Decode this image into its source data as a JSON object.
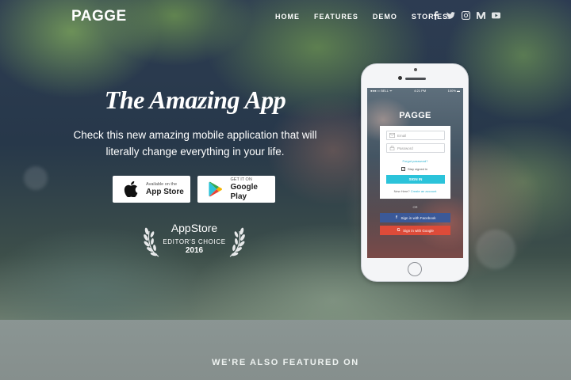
{
  "brand": {
    "logo": "PAGGE"
  },
  "nav": {
    "items": [
      "HOME",
      "FEATURES",
      "DEMO",
      "STORIES"
    ]
  },
  "social_icons": [
    "facebook-icon",
    "twitter-icon",
    "instagram-icon",
    "medium-icon",
    "youtube-icon"
  ],
  "hero": {
    "headline": "The Amazing App",
    "subtext": "Check this new amazing mobile application that will literally change everything in your life."
  },
  "store_buttons": {
    "appstore": {
      "small": "Available on the",
      "big": "App Store"
    },
    "googleplay": {
      "small": "GET IT ON",
      "big": "Google Play"
    }
  },
  "award": {
    "title": "AppStore",
    "subtitle": "EDITOR'S CHOICE",
    "year": "2016"
  },
  "phone": {
    "status_left": "●●●○○ BELL ᯤ",
    "status_time": "4:21 PM",
    "status_right": "100% ▬",
    "app_title": "PAGGE",
    "email_placeholder": "Email",
    "password_placeholder": "Password",
    "forgot": "Forgot password?",
    "stay_signed": "Stay signed in",
    "signin": "SIGN IN",
    "new_here": "New Here?",
    "create_account": "Create an account",
    "or": "OR",
    "facebook": "Sign in with Facebook",
    "google": "Sign in with Google"
  },
  "featured": {
    "title": "WE'RE ALSO FEATURED ON"
  },
  "colors": {
    "accent": "#2bc3da",
    "facebook": "#3b5998",
    "google": "#dd4b39",
    "featured_band": "#8a9593"
  }
}
